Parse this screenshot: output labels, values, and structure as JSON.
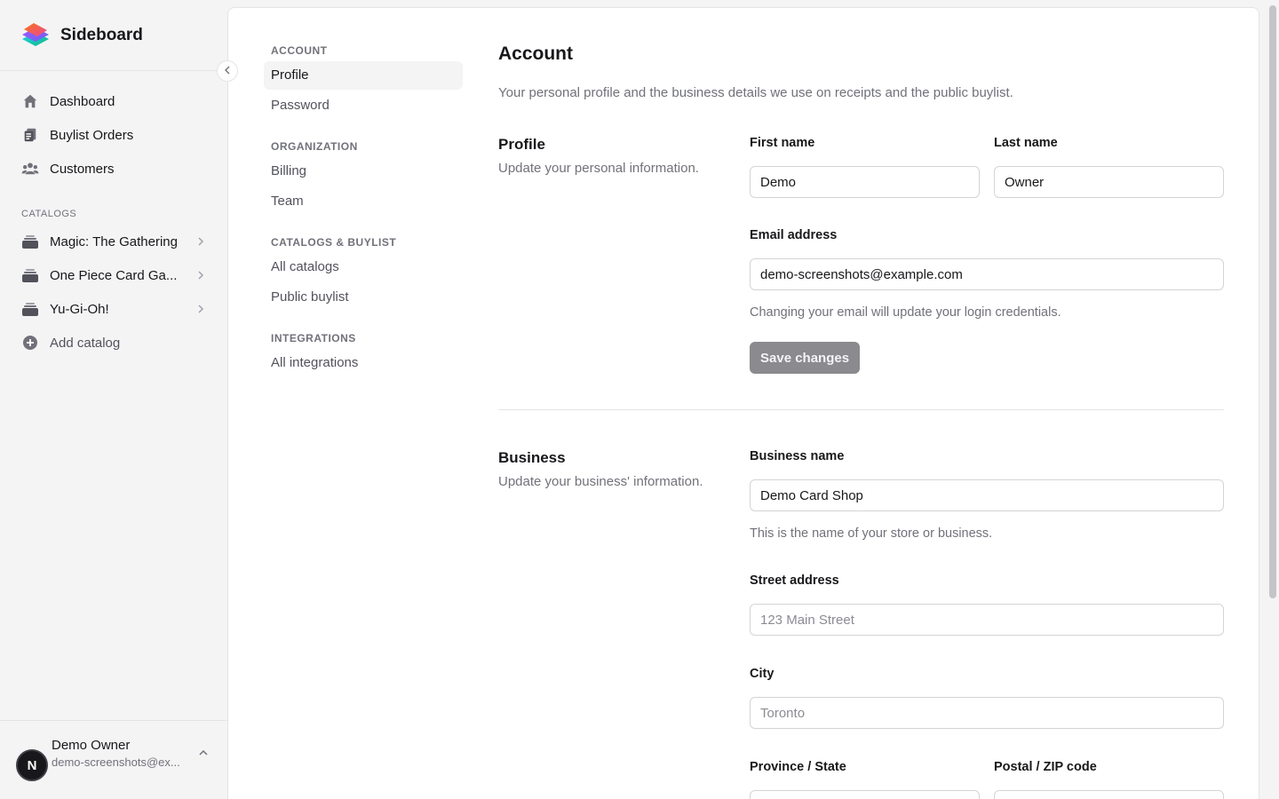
{
  "brand": {
    "name": "Sideboard"
  },
  "sidebar": {
    "nav": [
      {
        "label": "Dashboard",
        "icon": "home-icon"
      },
      {
        "label": "Buylist Orders",
        "icon": "orders-icon"
      },
      {
        "label": "Customers",
        "icon": "users-icon"
      }
    ],
    "catalogs_label": "CATALOGS",
    "catalogs": [
      {
        "label": "Magic: The Gathering",
        "icon": "stack-icon"
      },
      {
        "label": "One Piece Card Ga...",
        "icon": "stack-icon"
      },
      {
        "label": "Yu-Gi-Oh!",
        "icon": "stack-icon"
      }
    ],
    "add_catalog": "Add catalog",
    "user": {
      "initial": "N",
      "name": "Demo Owner",
      "email": "demo-screenshots@ex..."
    }
  },
  "settings_nav": {
    "groups": [
      {
        "label": "ACCOUNT",
        "items": [
          "Profile",
          "Password"
        ]
      },
      {
        "label": "ORGANIZATION",
        "items": [
          "Billing",
          "Team"
        ]
      },
      {
        "label": "CATALOGS & BUYLIST",
        "items": [
          "All catalogs",
          "Public buylist"
        ]
      },
      {
        "label": "INTEGRATIONS",
        "items": [
          "All integrations"
        ]
      }
    ],
    "active": "Profile"
  },
  "page": {
    "title": "Account",
    "description": "Your personal profile and the business details we use on receipts and the public buylist."
  },
  "profile": {
    "title": "Profile",
    "description": "Update your personal information.",
    "first_name_label": "First name",
    "first_name_value": "Demo",
    "last_name_label": "Last name",
    "last_name_value": "Owner",
    "email_label": "Email address",
    "email_value": "demo-screenshots@example.com",
    "email_hint": "Changing your email will update your login credentials.",
    "save_label": "Save changes"
  },
  "business": {
    "title": "Business",
    "description": "Update your business' information.",
    "name_label": "Business name",
    "name_value": "Demo Card Shop",
    "name_hint": "This is the name of your store or business.",
    "street_label": "Street address",
    "street_placeholder": "123 Main Street",
    "city_label": "City",
    "city_placeholder": "Toronto",
    "province_label": "Province / State",
    "postal_label": "Postal / ZIP code"
  },
  "colors": {
    "accent_button": "#8a8a8f",
    "sidebar_bg": "#f4f4f5",
    "panel_bg": "#ffffff"
  }
}
